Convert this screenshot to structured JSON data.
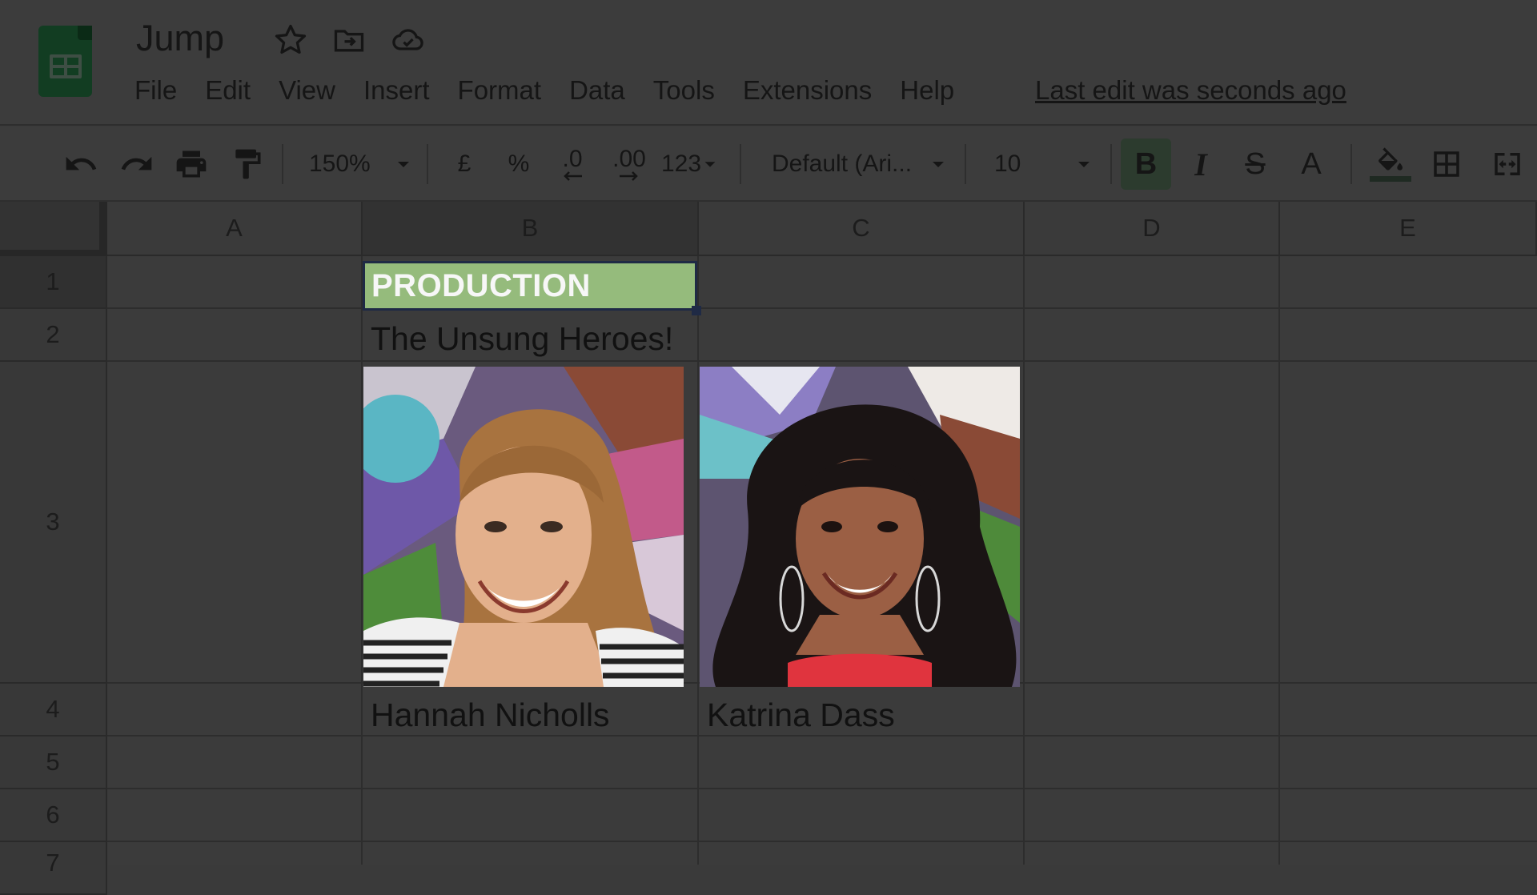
{
  "app": {
    "doc_title": "Jump",
    "last_edit": "Last edit was seconds ago"
  },
  "menu": [
    "File",
    "Edit",
    "View",
    "Insert",
    "Format",
    "Data",
    "Tools",
    "Extensions",
    "Help"
  ],
  "toolbar": {
    "zoom": "150%",
    "currency": "£",
    "percent": "%",
    "decrease_decimal": ".0",
    "increase_decimal": ".00",
    "more_formats": "123",
    "font": "Default (Ari...",
    "font_size": "10",
    "bold": "B",
    "italic": "I",
    "strikethrough": "S",
    "text_color": "A"
  },
  "columns": [
    "A",
    "B",
    "C",
    "D",
    "E"
  ],
  "rows": [
    "1",
    "2",
    "3",
    "4",
    "5",
    "6",
    "7"
  ],
  "cells": {
    "B1": "PRODUCTION",
    "B2": "The Unsung Heroes!",
    "B4": "Hannah Nicholls",
    "C4": "Katrina Dass"
  },
  "icons": {
    "star": "star-icon",
    "move": "move-to-folder-icon",
    "cloud": "cloud-saved-icon"
  },
  "colors": {
    "production_fill": "#95bb7c",
    "selection": "#1f2a45"
  }
}
